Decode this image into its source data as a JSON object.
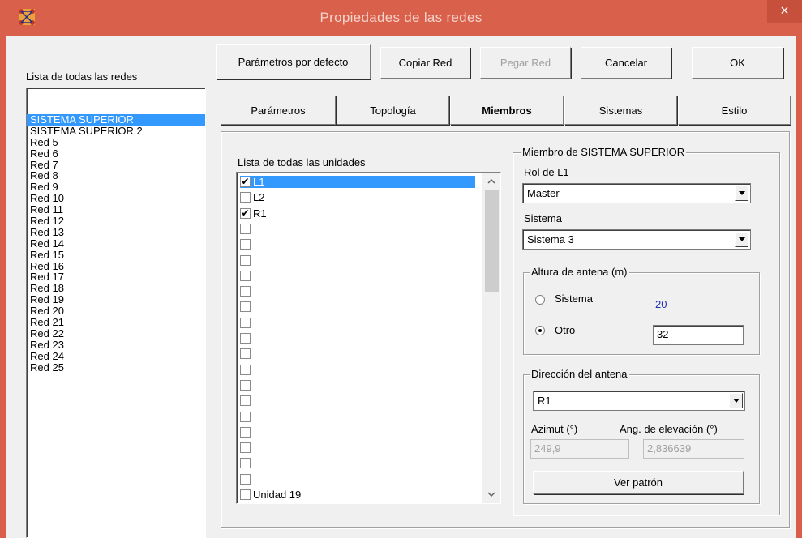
{
  "window": {
    "title": "Propiedades de las redes",
    "close_glyph": "×",
    "icon": "network-app-icon",
    "accent": "#d9604a"
  },
  "toolbar": {
    "defaults_label": "Parámetros por defecto",
    "copy_label": "Copiar Red",
    "paste_label": "Pegar Red",
    "cancel_label": "Cancelar",
    "ok_label": "OK"
  },
  "network_list": {
    "label": "Lista de todas las redes",
    "selected": "SISTEMA SUPERIOR",
    "items": [
      "",
      "SISTEMA SUPERIOR",
      "SISTEMA SUPERIOR 2",
      "Red  5",
      "Red  6",
      "Red  7",
      "Red  8",
      "Red  9",
      "Red 10",
      "Red 11",
      "Red 12",
      "Red 13",
      "Red 14",
      "Red 15",
      "Red 16",
      "Red 17",
      "Red 18",
      "Red 19",
      "Red 20",
      "Red 21",
      "Red 22",
      "Red 23",
      "Red 24",
      "Red 25"
    ]
  },
  "tabs": [
    {
      "label": "Parámetros",
      "active": false
    },
    {
      "label": "Topología",
      "active": false
    },
    {
      "label": "Miembros",
      "active": true
    },
    {
      "label": "Sistemas",
      "active": false
    },
    {
      "label": "Estilo",
      "active": false
    }
  ],
  "units": {
    "label": "Lista de todas las unidades",
    "items": [
      {
        "label": "L1",
        "checked": true,
        "selected": true
      },
      {
        "label": "L2",
        "checked": false
      },
      {
        "label": "R1",
        "checked": true
      },
      {
        "label": "",
        "checked": false
      },
      {
        "label": "",
        "checked": false
      },
      {
        "label": "",
        "checked": false
      },
      {
        "label": "",
        "checked": false
      },
      {
        "label": "",
        "checked": false
      },
      {
        "label": "",
        "checked": false
      },
      {
        "label": "",
        "checked": false
      },
      {
        "label": "",
        "checked": false
      },
      {
        "label": "",
        "checked": false
      },
      {
        "label": "",
        "checked": false
      },
      {
        "label": "",
        "checked": false
      },
      {
        "label": "",
        "checked": false
      },
      {
        "label": "",
        "checked": false
      },
      {
        "label": "",
        "checked": false
      },
      {
        "label": "",
        "checked": false
      },
      {
        "label": "",
        "checked": false
      },
      {
        "label": "",
        "checked": false
      },
      {
        "label": "Unidad  19",
        "checked": false
      }
    ]
  },
  "member": {
    "group_title": "Miembro de SISTEMA SUPERIOR",
    "role_label": "Rol de L1",
    "role_value": "Master",
    "system_label": "Sistema",
    "system_value": "Sistema  3",
    "antenna_height": {
      "title": "Altura de antena (m)",
      "option_system": "Sistema",
      "system_value": "20",
      "option_other": "Otro",
      "other_value": "32",
      "selected": "Otro"
    },
    "direction": {
      "title": "Dirección del antena",
      "target": "R1",
      "azimuth_label": "Azimut (°)",
      "elevation_label": "Ang. de elevación (°)",
      "azimuth_value": "249,9",
      "elevation_value": "2,836639",
      "pattern_button": "Ver patrón"
    }
  }
}
